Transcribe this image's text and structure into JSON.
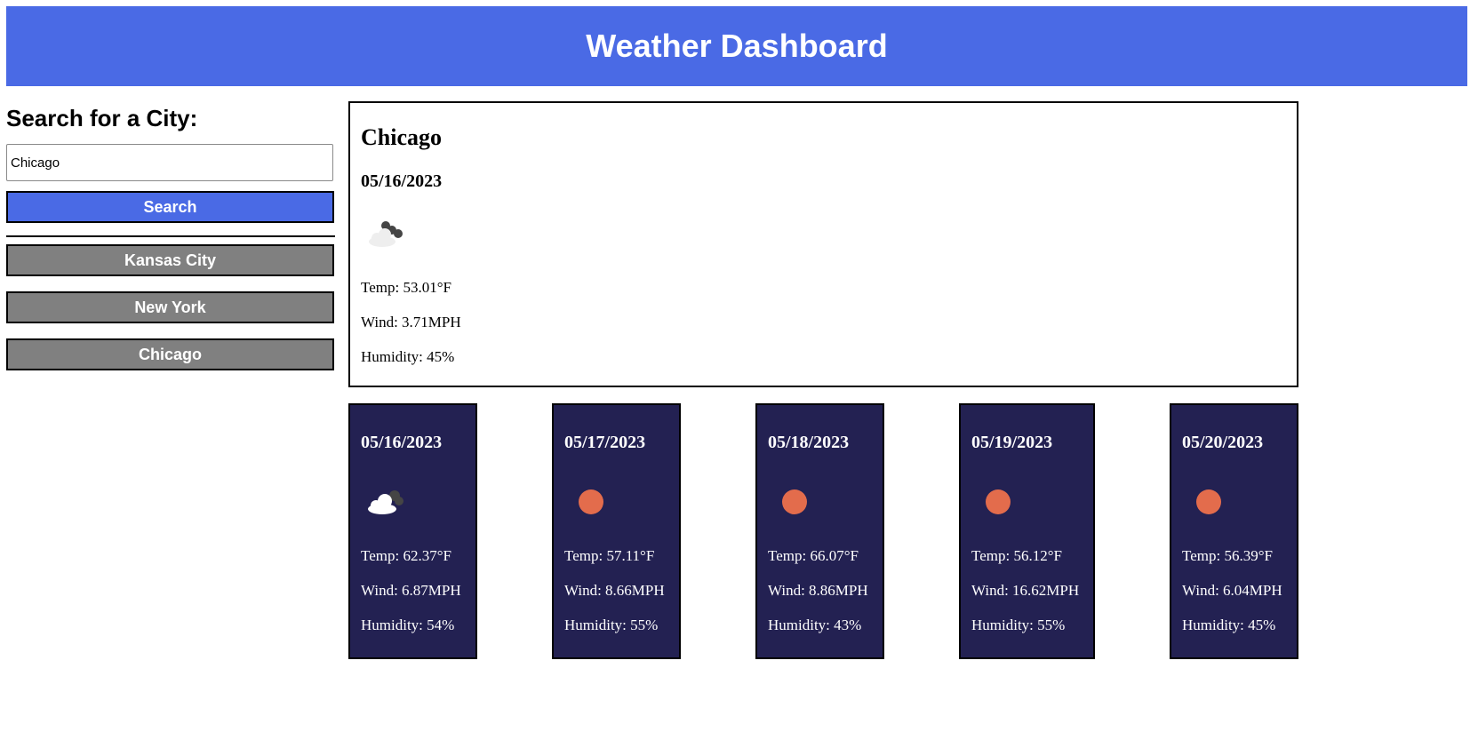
{
  "header": {
    "title": "Weather Dashboard"
  },
  "sidebar": {
    "heading": "Search for a City:",
    "search_value": "Chicago",
    "search_button": "Search",
    "history": [
      "Kansas City",
      "New York",
      "Chicago"
    ]
  },
  "current": {
    "city": "Chicago",
    "date": "05/16/2023",
    "icon": "partly-cloudy-icon",
    "temp": "Temp: 53.01°F",
    "wind": "Wind: 3.71MPH",
    "humidity": "Humidity: 45%"
  },
  "forecast": [
    {
      "date": "05/16/2023",
      "icon": "cloud-icon",
      "temp": "Temp: 62.37°F",
      "wind": "Wind: 6.87MPH",
      "humidity": "Humidity: 54%"
    },
    {
      "date": "05/17/2023",
      "icon": "sun-icon",
      "temp": "Temp: 57.11°F",
      "wind": "Wind: 8.66MPH",
      "humidity": "Humidity: 55%"
    },
    {
      "date": "05/18/2023",
      "icon": "sun-icon",
      "temp": "Temp: 66.07°F",
      "wind": "Wind: 8.86MPH",
      "humidity": "Humidity: 43%"
    },
    {
      "date": "05/19/2023",
      "icon": "sun-icon",
      "temp": "Temp: 56.12°F",
      "wind": "Wind: 16.62MPH",
      "humidity": "Humidity: 55%"
    },
    {
      "date": "05/20/2023",
      "icon": "sun-icon",
      "temp": "Temp: 56.39°F",
      "wind": "Wind: 6.04MPH",
      "humidity": "Humidity: 45%"
    }
  ],
  "colors": {
    "header_bg": "#4a6ae5",
    "forecast_bg": "#232152",
    "history_button_bg": "#808080",
    "sun": "#e36c4c"
  }
}
